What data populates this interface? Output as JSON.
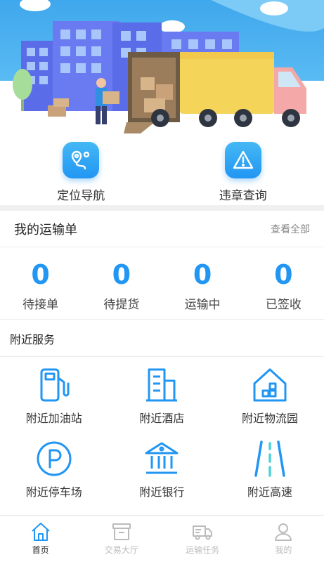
{
  "colors": {
    "accent": "#2196f3",
    "inactive": "#bbbbbb"
  },
  "quick": [
    {
      "label": "定位导航",
      "icon": "location-navigation-icon"
    },
    {
      "label": "违章查询",
      "icon": "warning-triangle-icon"
    }
  ],
  "orders": {
    "title": "我的运输单",
    "more": "查看全部",
    "stats": [
      {
        "value": "0",
        "label": "待接单"
      },
      {
        "value": "0",
        "label": "待提货"
      },
      {
        "value": "0",
        "label": "运输中"
      },
      {
        "value": "0",
        "label": "已签收"
      }
    ]
  },
  "nearby": {
    "title": "附近服务",
    "items": [
      {
        "label": "附近加油站",
        "icon": "gas-station-icon"
      },
      {
        "label": "附近酒店",
        "icon": "hotel-building-icon"
      },
      {
        "label": "附近物流园",
        "icon": "logistics-park-icon"
      },
      {
        "label": "附近停车场",
        "icon": "parking-icon"
      },
      {
        "label": "附近银行",
        "icon": "bank-icon"
      },
      {
        "label": "附近高速",
        "icon": "highway-icon"
      }
    ]
  },
  "tabs": [
    {
      "label": "首页",
      "icon": "home-icon",
      "active": true
    },
    {
      "label": "交易大厅",
      "icon": "trading-hall-icon",
      "active": false
    },
    {
      "label": "运输任务",
      "icon": "truck-icon",
      "active": false
    },
    {
      "label": "我的",
      "icon": "user-icon",
      "active": false
    }
  ]
}
